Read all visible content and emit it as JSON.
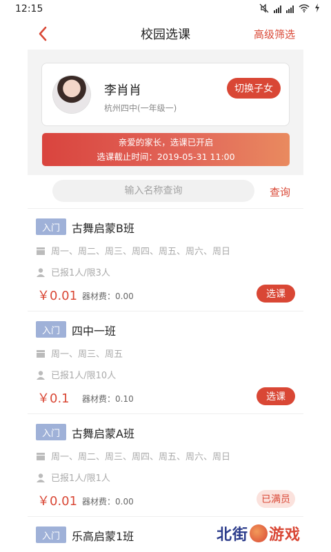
{
  "status_bar": {
    "time": "12:15"
  },
  "nav": {
    "title": "校园选课",
    "filter_label": "高级筛选"
  },
  "profile": {
    "name": "李肖肖",
    "school": "杭州四中(一年级一)",
    "switch_label": "切换子女"
  },
  "notice": {
    "line1": "亲爱的家长，选课已开启",
    "line2": "选课截止时间：2019-05-31 11:00"
  },
  "search": {
    "placeholder": "输入名称查询",
    "button_label": "查询"
  },
  "courses": [
    {
      "tag": "入门",
      "name": "古舞启蒙B班",
      "days": "周一、周二、周三、周四、周五、周六、周日",
      "enrollment": "已报1人/限3人",
      "price": "￥0.01",
      "fee": "器材费：0.00",
      "action": "选课"
    },
    {
      "tag": "入门",
      "name": "四中一班",
      "days": "周一、周三、周五",
      "enrollment": "已报1人/限10人",
      "price": "￥0.1",
      "fee": "器材费：0.10",
      "action": "选课"
    },
    {
      "tag": "入门",
      "name": "古舞启蒙A班",
      "days": "周一、周二、周三、周四、周五、周六、周日",
      "enrollment": "已报1人/限1人",
      "price": "￥0.01",
      "fee": "器材费：0.00",
      "action": "已满员"
    },
    {
      "tag": "入门",
      "name": "乐高启蒙1班"
    }
  ],
  "watermark": {
    "left": "北街",
    "right": "游戏"
  },
  "colors": {
    "accent": "#d94735",
    "tag": "#9fb1d8"
  }
}
